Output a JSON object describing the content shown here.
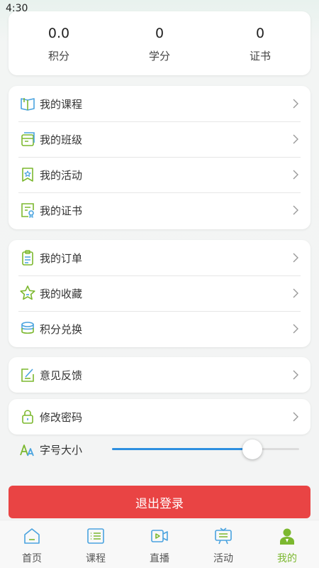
{
  "status_bar": {
    "time": "4:30"
  },
  "stats": [
    {
      "value": "0.0",
      "label": "积分"
    },
    {
      "value": "0",
      "label": "学分"
    },
    {
      "value": "0",
      "label": "证书"
    }
  ],
  "menu": {
    "group1": [
      {
        "label": "我的课程",
        "icon": "book-icon"
      },
      {
        "label": "我的班级",
        "icon": "class-icon"
      },
      {
        "label": "我的活动",
        "icon": "activity-icon"
      },
      {
        "label": "我的证书",
        "icon": "certificate-icon"
      }
    ],
    "group2": [
      {
        "label": "我的订单",
        "icon": "order-icon"
      },
      {
        "label": "我的收藏",
        "icon": "star-icon"
      },
      {
        "label": "积分兑换",
        "icon": "coins-icon"
      }
    ],
    "feedback": {
      "label": "意见反馈",
      "icon": "feedback-icon"
    },
    "password": {
      "label": "修改密码",
      "icon": "lock-icon"
    }
  },
  "font_size": {
    "label": "字号大小",
    "level": 0.75
  },
  "logout_label": "退出登录",
  "tabbar": [
    {
      "label": "首页",
      "icon": "home-icon"
    },
    {
      "label": "课程",
      "icon": "course-list-icon"
    },
    {
      "label": "直播",
      "icon": "live-video-icon"
    },
    {
      "label": "活动",
      "icon": "activity-board-icon"
    },
    {
      "label": "我的",
      "icon": "profile-icon",
      "active": true
    }
  ],
  "colors": {
    "accent_green": "#7cb82f",
    "icon_blue": "#4aa3df",
    "logout_red": "#e94444",
    "slider_blue": "#2e8fe0"
  }
}
